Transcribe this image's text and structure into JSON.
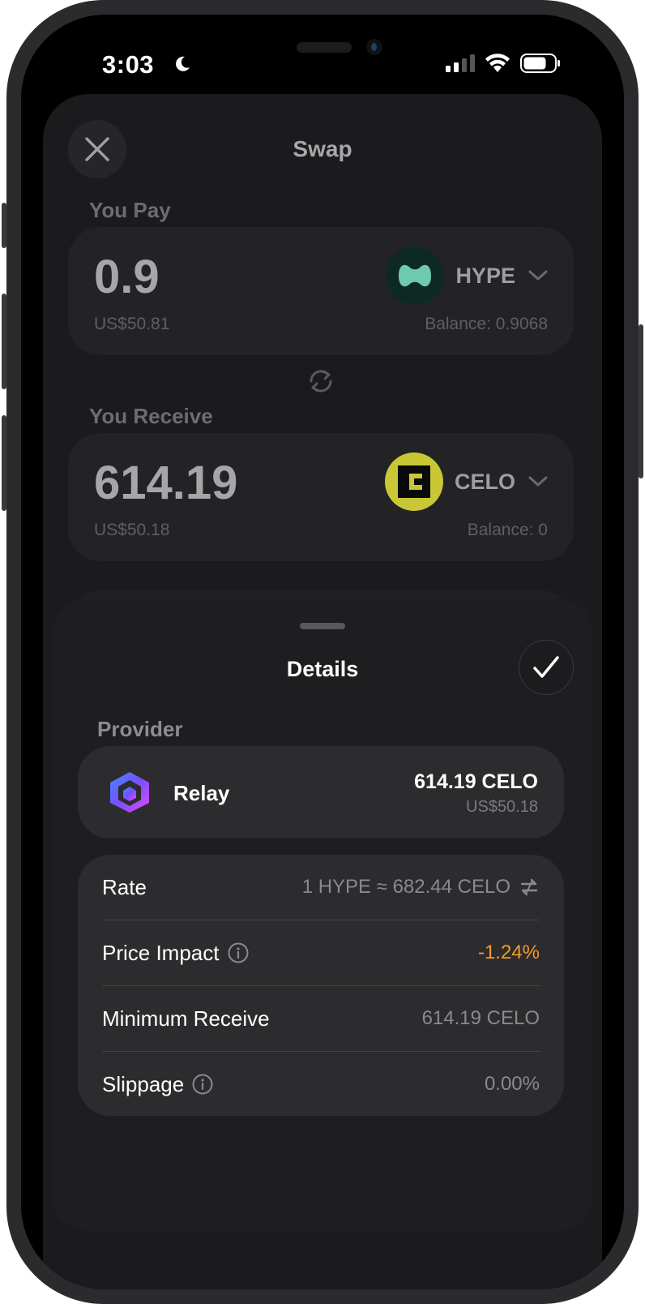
{
  "status_bar": {
    "time": "3:03"
  },
  "header": {
    "title": "Swap"
  },
  "pay": {
    "label": "You Pay",
    "amount": "0.9",
    "usd": "US$50.81",
    "balance": "Balance: 0.9068",
    "token": {
      "symbol": "HYPE",
      "color": "#0d2a22",
      "accent": "#6fd6b8"
    }
  },
  "receive": {
    "label": "You Receive",
    "amount": "614.19",
    "usd": "US$50.18",
    "balance": "Balance: 0",
    "token": {
      "symbol": "CELO",
      "color": "#d4d23a"
    }
  },
  "details": {
    "title": "Details",
    "provider_label": "Provider",
    "provider": {
      "name": "Relay",
      "amount": "614.19 CELO",
      "usd": "US$50.18"
    },
    "rows": [
      {
        "label": "Rate",
        "value": "1 HYPE ≈ 682.44 CELO"
      },
      {
        "label": "Price Impact",
        "value": "-1.24%"
      },
      {
        "label": "Minimum Receive",
        "value": "614.19 CELO"
      },
      {
        "label": "Slippage",
        "value": "0.00%"
      }
    ]
  },
  "colors": {
    "negative": "#f39a2b",
    "background": "#000000"
  }
}
